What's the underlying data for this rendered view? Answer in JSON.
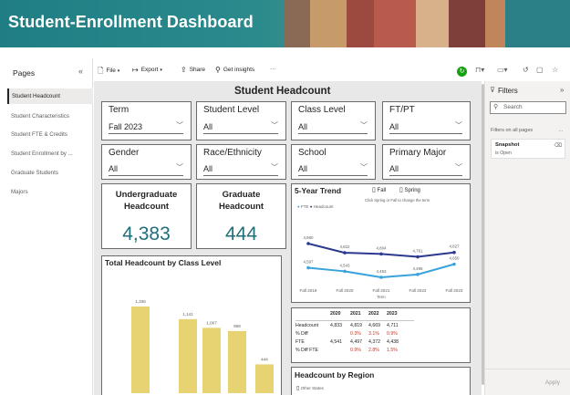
{
  "banner": {
    "title": "Student-Enrollment Dashboard"
  },
  "sidebar": {
    "heading": "Pages",
    "collapse_icon": "double-chevron-left-icon",
    "items": [
      {
        "label": "Student Headcount",
        "active": true
      },
      {
        "label": "Student Characteristics"
      },
      {
        "label": "Student FTE & Credits"
      },
      {
        "label": "Student Enrollment by ..."
      },
      {
        "label": "Graduate Students"
      },
      {
        "label": "Majors"
      }
    ]
  },
  "toolbar": {
    "file": "File",
    "export": "Export",
    "share": "Share",
    "insights": "Get insights",
    "more": "···"
  },
  "report": {
    "title": "Student Headcount",
    "slicers": [
      {
        "title": "Term",
        "value": "Fall 2023"
      },
      {
        "title": "Student Level",
        "value": "All"
      },
      {
        "title": "Class Level",
        "value": "All"
      },
      {
        "title": "FT/PT",
        "value": "All"
      },
      {
        "title": "Gender",
        "value": "All"
      },
      {
        "title": "Race/Ethnicity",
        "value": "All"
      },
      {
        "title": "School",
        "value": "All"
      },
      {
        "title": "Primary Major",
        "value": "All"
      }
    ],
    "kpi_undergrad": {
      "title_line1": "Undergraduate",
      "title_line2": "Headcount",
      "value": "4,383"
    },
    "kpi_grad": {
      "title_line1": "Graduate",
      "title_line2": "Headcount",
      "value": "444"
    },
    "class_level_chart_title": "Total Headcount by Class Level",
    "trend": {
      "title": "5-Year Trend",
      "toggle_fall": "Fall",
      "toggle_spring": "Spring",
      "hint": "Click Spring or Fall to change the term",
      "legend_fte": "FTE",
      "legend_headcount": "Headcount",
      "xlabel": "Term"
    },
    "table": {
      "headers": [
        "",
        "2020",
        "2021",
        "2022",
        "2023"
      ],
      "rows": [
        [
          "Headcount",
          "4,833",
          "4,819",
          "4,669",
          "4,711"
        ],
        [
          "% Diff",
          "",
          "0.3%",
          "3.1%",
          "0.9%"
        ],
        [
          "FTE",
          "4,541",
          "4,497",
          "4,372",
          "4,438"
        ],
        [
          "% Diff FTE",
          "",
          "0.9%",
          "2.8%",
          "1.5%"
        ]
      ]
    },
    "region": {
      "title": "Headcount by Region",
      "legend": "Other States"
    }
  },
  "filters": {
    "title": "Filters",
    "search_placeholder": "Search",
    "section": "Filters on all pages",
    "card_name": "Snapshot",
    "card_value": "is Open",
    "apply": "Apply"
  },
  "colors": {
    "banner_teal": "#1f7e84",
    "kpi_teal": "#1f6f7a",
    "bar_gold": "#e7d372",
    "headcount_line": "#2b3a8f",
    "fte_line": "#3aa3dd",
    "refresh_green": "#13a10e"
  },
  "chart_data": [
    {
      "type": "bar",
      "title": "Total Headcount by Class Level",
      "categories": [
        "",
        "",
        "",
        "",
        ""
      ],
      "values": [
        1336,
        1141,
        1007,
        958,
        444
      ],
      "data_labels": [
        "1,336",
        "1,141",
        "1,007",
        "958",
        "444"
      ]
    },
    {
      "type": "line",
      "title": "5-Year Trend",
      "x": [
        "Fall 2019",
        "Fall 2020",
        "Fall 2021",
        "Fall 2022",
        "Fall 2023"
      ],
      "xlabel": "Term",
      "series": [
        {
          "name": "Headcount",
          "values": [
            4960,
            4822,
            4804,
            4761,
            4827
          ],
          "labels": [
            "4,960",
            "4,822",
            "4,804",
            "4,761",
            "4,827"
          ]
        },
        {
          "name": "FTE",
          "values": [
            4597,
            4543,
            4453,
            4496,
            4650
          ],
          "labels": [
            "4,597",
            "4,543",
            "4,453",
            "4,496",
            "4,650"
          ]
        }
      ]
    }
  ]
}
